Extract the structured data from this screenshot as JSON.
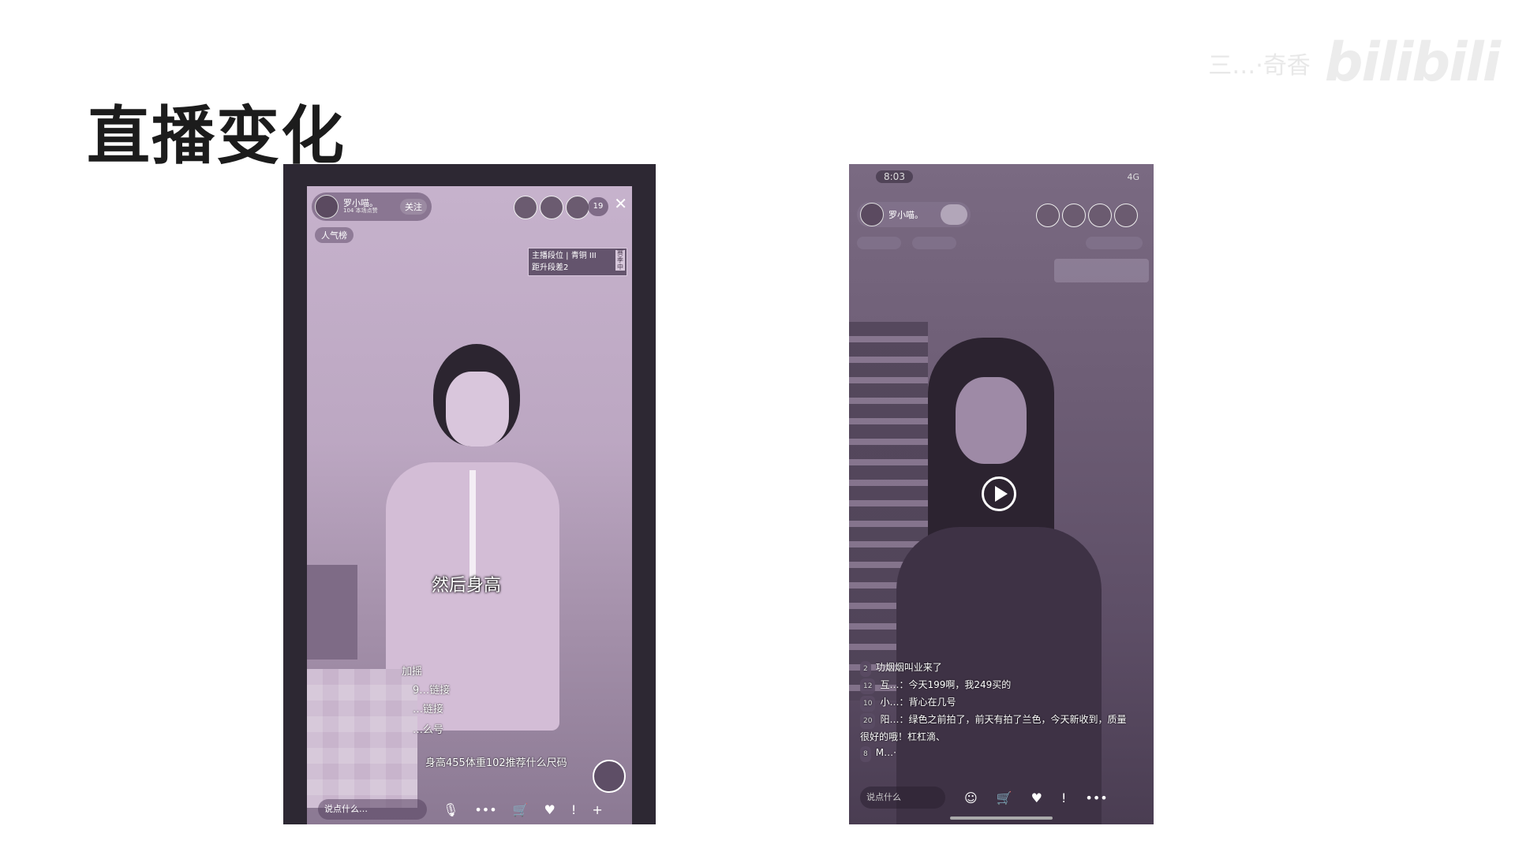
{
  "slide": {
    "title": "直播变化",
    "watermark_user": "三…·奇香",
    "watermark_logo": "bilibili"
  },
  "phone1": {
    "streamer_name": "罗小喵。",
    "likes_text": "104 本场点赞",
    "follow_label": "关注",
    "viewer_count": "19",
    "hot_badge": "人气榜",
    "rank_line1": "主播段位 | 青铜 III",
    "rank_line2": "距升段差2",
    "rank_tag": "赛季中",
    "subtitle": "然后身高",
    "chat": [
      "加摇",
      "9…链接",
      "…链接",
      "…么号",
      "身高455体重102推荐什么尺码"
    ],
    "input_placeholder": "说点什么…",
    "bottom_icons": [
      "mic-icon",
      "more-icon",
      "cart-icon",
      "gift-icon",
      "share-icon",
      "plus-icon"
    ]
  },
  "phone2": {
    "status_time": "8:03",
    "status_right": "4G",
    "streamer_name": "罗小喵。",
    "chat": [
      {
        "level": "2",
        "text": "功烟烟叫业来了"
      },
      {
        "level": "12",
        "text": "互…：今天199啊，我249买的"
      },
      {
        "level": "10",
        "text": "小…：背心在几号"
      },
      {
        "level": "20",
        "text": "阳…：绿色之前拍了，前天有拍了兰色，今天新收到，质量很好的哦！杠杠滴、"
      },
      {
        "level": "8",
        "text": "M…·"
      }
    ],
    "input_placeholder": "说点什么"
  }
}
